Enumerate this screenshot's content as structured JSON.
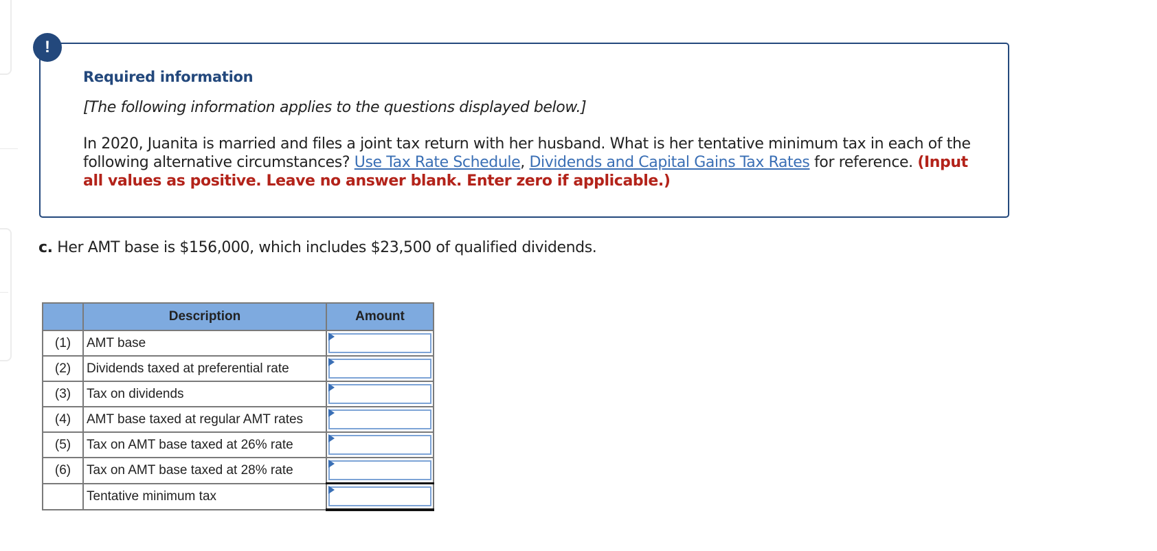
{
  "info": {
    "badge_icon": "!",
    "title": "Required information",
    "subtitle": "[The following information applies to the questions displayed below.]",
    "body_text": "In 2020, Juanita is married and files a joint tax return with her husband. What is her tentative minimum tax in each of the following alternative circumstances?",
    "link1": "Use Tax Rate Schedule",
    "separator": ",",
    "link2": "Dividends and Capital Gains Tax Rates",
    "after_links": "for reference.",
    "warning": "(Input all values as positive. Leave no answer blank. Enter zero if applicable.)"
  },
  "question": {
    "label": "c.",
    "text": "Her AMT base is $156,000, which includes $23,500 of qualified dividends."
  },
  "table": {
    "headers": {
      "num": "",
      "description": "Description",
      "amount": "Amount"
    },
    "rows": [
      {
        "num": "(1)",
        "description": "AMT base",
        "amount": ""
      },
      {
        "num": "(2)",
        "description": "Dividends taxed at preferential rate",
        "amount": ""
      },
      {
        "num": "(3)",
        "description": "Tax on dividends",
        "amount": ""
      },
      {
        "num": "(4)",
        "description": "AMT base taxed at regular AMT rates",
        "amount": ""
      },
      {
        "num": "(5)",
        "description": "Tax on AMT base taxed at 26% rate",
        "amount": ""
      },
      {
        "num": "(6)",
        "description": "Tax on AMT base taxed at 28% rate",
        "amount": ""
      },
      {
        "num": "",
        "description": "Tentative minimum tax",
        "amount": ""
      }
    ]
  },
  "colors": {
    "accent": "#23487c",
    "link": "#3a6fb5",
    "warning": "#b3231a",
    "table_header": "#7eaadf"
  }
}
